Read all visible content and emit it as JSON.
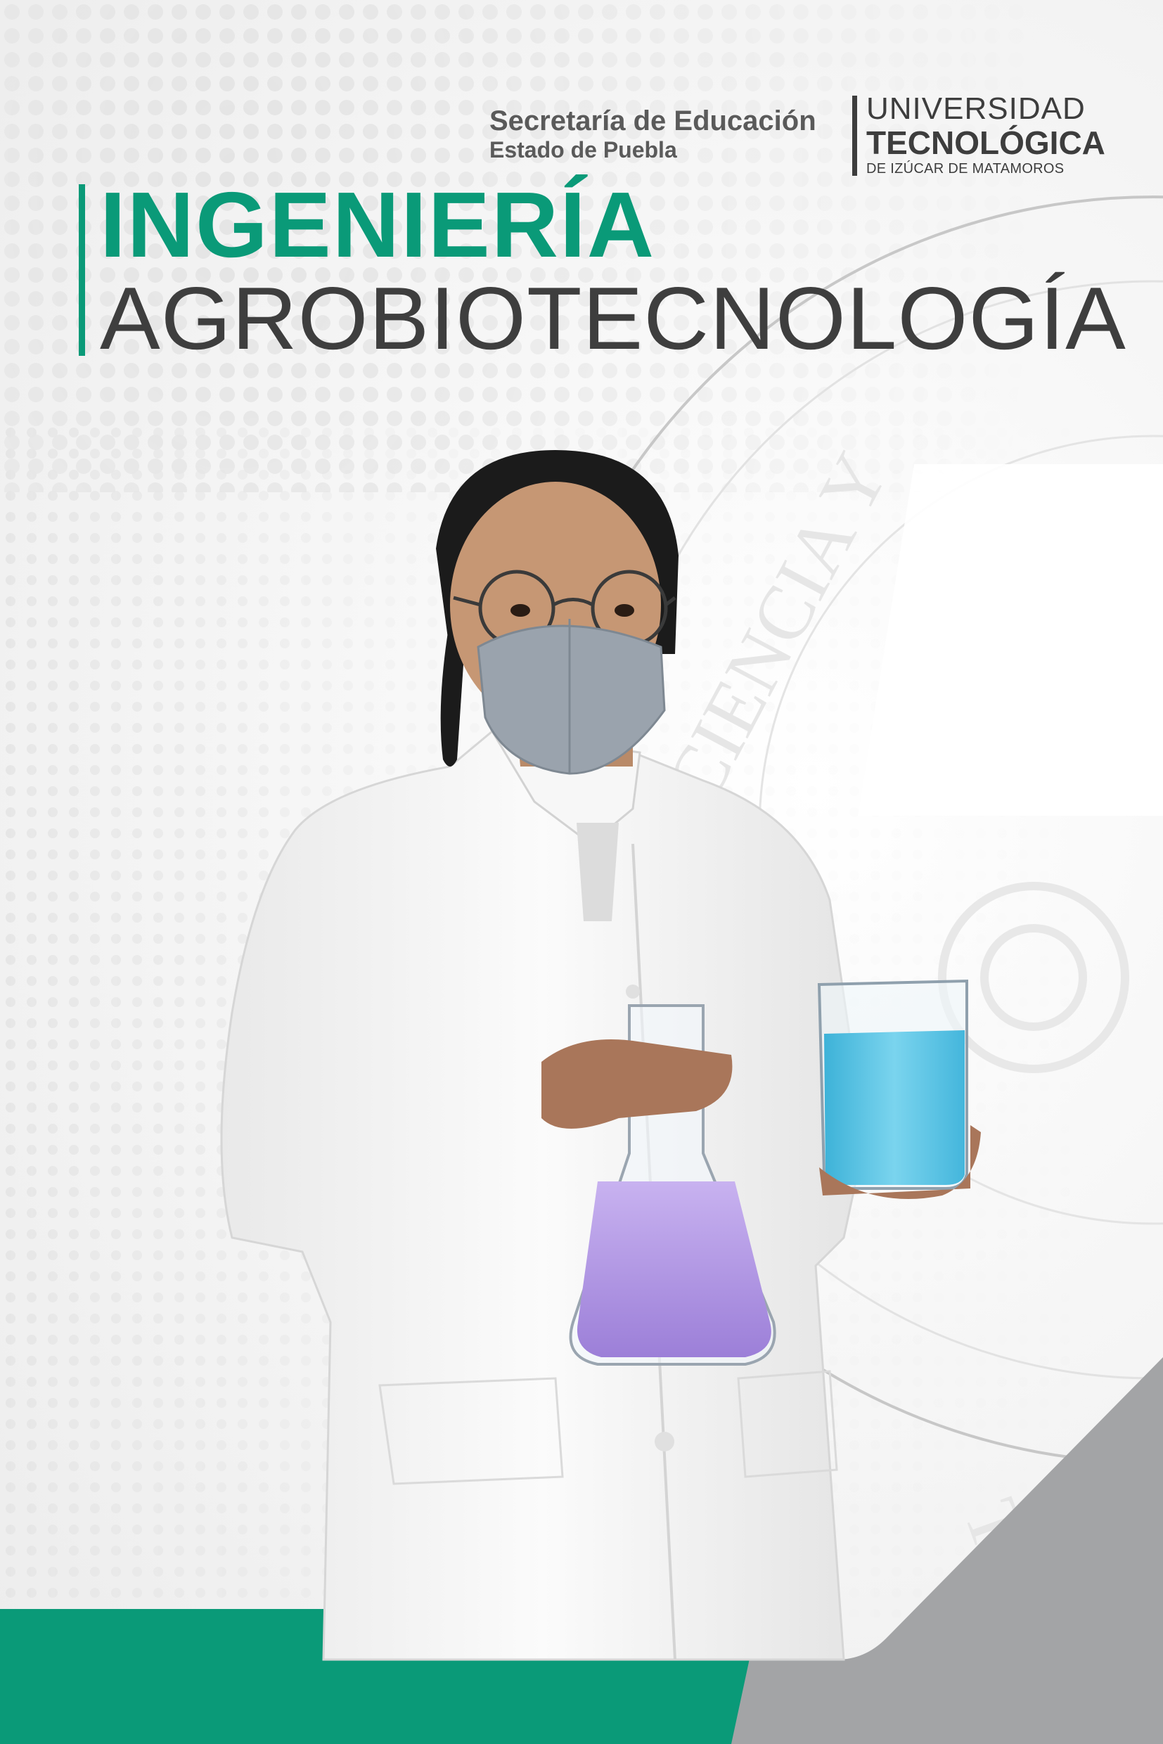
{
  "header": {
    "sep": {
      "line1": "Secretaría de Educación",
      "line2": "Estado de Puebla"
    },
    "university": {
      "line1": "UNIVERSIDAD",
      "line2": "TECNOLÓGICA",
      "line3": "DE IZÚCAR DE MATAMOROS"
    }
  },
  "title": {
    "line1": "INGENIERÍA",
    "line2": "AGROBIOTECNOLOGÍA"
  },
  "colors": {
    "accent_green": "#0a9a78",
    "dark_gray": "#3e3e3e",
    "footer_gray": "#a3a4a6",
    "flask_liquid": "#b49ae6",
    "beaker_liquid": "#5cc6e6"
  },
  "photo": {
    "subject": "student in white lab coat with face mask holding flask and beaker"
  }
}
